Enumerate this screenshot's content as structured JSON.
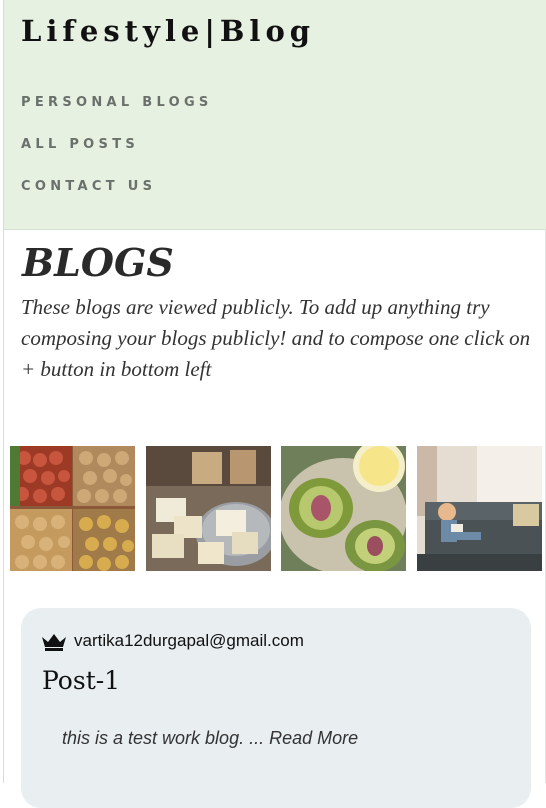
{
  "header": {
    "brand": "Lifestyle|Blog",
    "nav": [
      "PERSONAL BLOGS",
      "ALL POSTS",
      "CONTACT US"
    ]
  },
  "main": {
    "title": "BLOGS",
    "intro": "These blogs are viewed publicly. To add up anything try composing your blogs publicly! and to compose one click on + button in bottom left"
  },
  "gallery": {
    "images": [
      "produce-crates",
      "cheese-market",
      "artichoke-lemon",
      "child-reading-sofa"
    ]
  },
  "post": {
    "author_email": "vartika12durgapal@gmail.com",
    "author_icon": "crown-icon",
    "title": "Post-1",
    "excerpt": "this is a test work blog. ... ",
    "read_more": "Read More"
  },
  "colors": {
    "header_bg": "#e6f1e2",
    "card_bg": "#e9eef1",
    "nav_text": "#6b706b"
  }
}
